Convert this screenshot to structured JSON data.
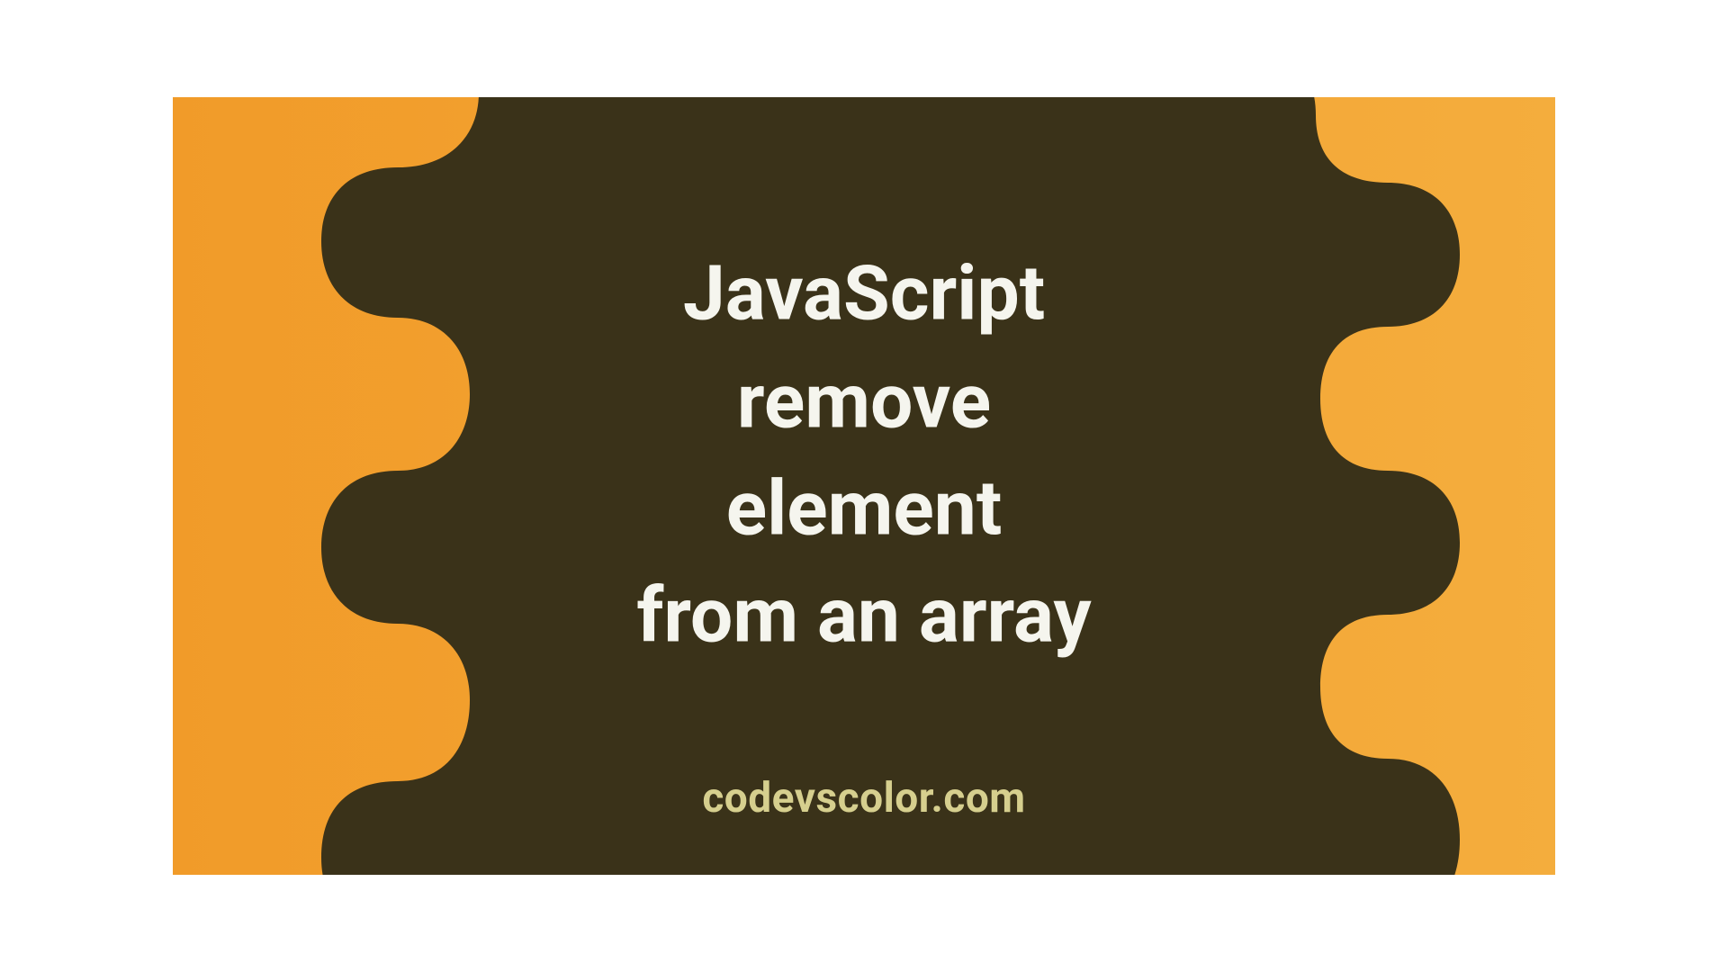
{
  "title_lines": "JavaScript\nremove\nelement\nfrom an array",
  "site": "codevscolor.com",
  "colors": {
    "bg_left": "#f19b29",
    "bg_right": "#f4ad3d",
    "blob": "#3a3219",
    "title": "#f5f5ee",
    "site": "#d6cf8e"
  }
}
